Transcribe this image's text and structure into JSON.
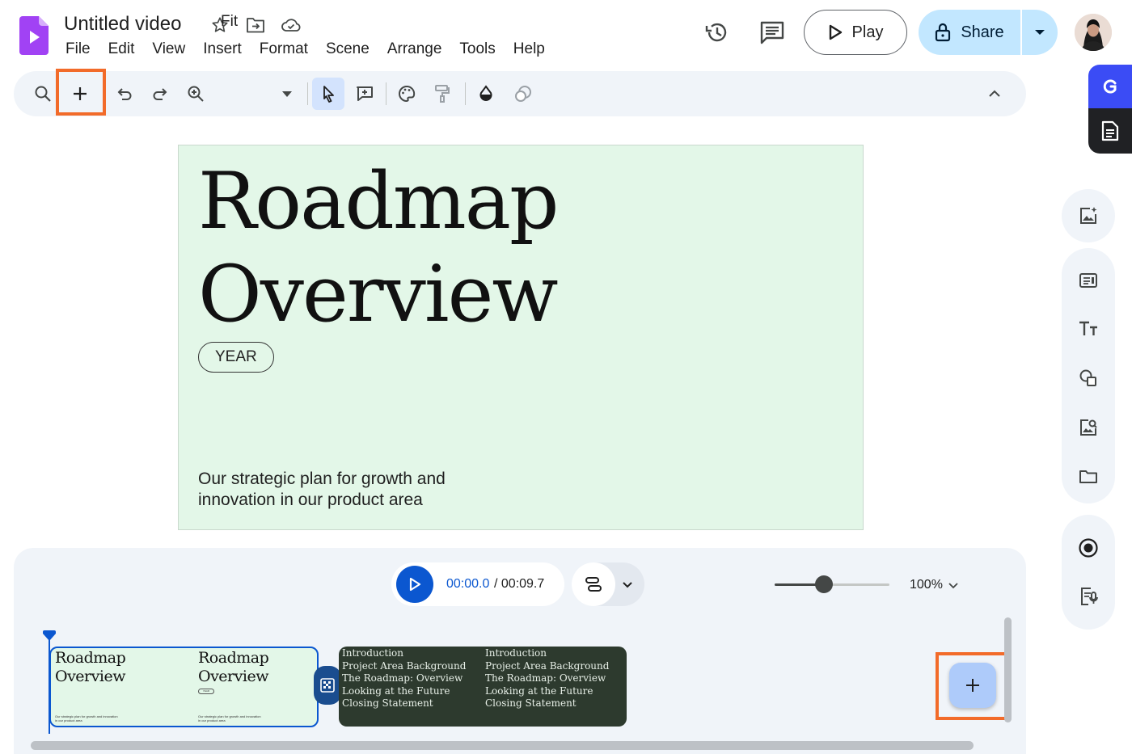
{
  "header": {
    "title": "Untitled video",
    "menu": [
      "File",
      "Edit",
      "View",
      "Insert",
      "Format",
      "Scene",
      "Arrange",
      "Tools",
      "Help"
    ],
    "play_label": "Play",
    "share_label": "Share"
  },
  "toolbar": {
    "zoom_label": "Fit"
  },
  "slide": {
    "title_line1": "Roadmap",
    "title_line2": "Overview",
    "chip": "YEAR",
    "subtitle": "Our strategic plan for growth and innovation in our product area"
  },
  "timeline": {
    "current_time": "00:00.0",
    "total_time": " / 00:09.7",
    "zoom_level": "100%",
    "zoom_fraction": 0.43,
    "clip1": {
      "title_line1": "Roadmap",
      "title_line2": "Overview",
      "chip": "YEAR",
      "subtitle": "Our strategic plan for growth and innovation in our product area"
    },
    "clip2": {
      "items": [
        "Introduction",
        "Project Area Background",
        "The Roadmap: Overview",
        "Looking at the Future",
        "Closing Statement"
      ]
    }
  },
  "colors": {
    "accent": "#0b57d0",
    "highlight": "#f26b2a",
    "slide_bg": "#e3f7e8",
    "clip2_bg": "#2d3a2e"
  }
}
